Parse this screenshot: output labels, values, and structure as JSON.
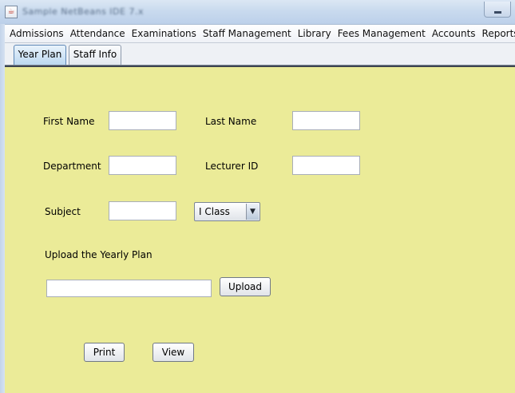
{
  "window": {
    "title": "Sample  NetBeans IDE 7.x",
    "app_icon": "java-cup-icon",
    "minimize_glyph": "minimize-icon"
  },
  "menubar": {
    "items": [
      "Admissions",
      "Attendance",
      "Examinations",
      "Staff Management",
      "Library",
      "Fees Management",
      "Accounts",
      "Reports"
    ]
  },
  "tabs": [
    {
      "label": "Year Plan",
      "selected": true
    },
    {
      "label": "Staff Info",
      "selected": false
    }
  ],
  "form": {
    "first_name": {
      "label": "First Name",
      "value": ""
    },
    "last_name": {
      "label": "Last Name",
      "value": ""
    },
    "department": {
      "label": "Department",
      "value": ""
    },
    "lecturer_id": {
      "label": "Lecturer ID",
      "value": ""
    },
    "subject": {
      "label": "Subject",
      "value": ""
    },
    "class_select": {
      "selected": "I Class",
      "arrow_icon": "dropdown-arrow-icon"
    },
    "upload_section": {
      "label": "Upload the Yearly Plan",
      "file_path": "",
      "upload_button": "Upload"
    },
    "print_button": "Print",
    "view_button": "View"
  },
  "colors": {
    "panel_background": "#ebeb98",
    "titlebar": "#c9daee",
    "selected_tab": "#bcd8f0"
  }
}
